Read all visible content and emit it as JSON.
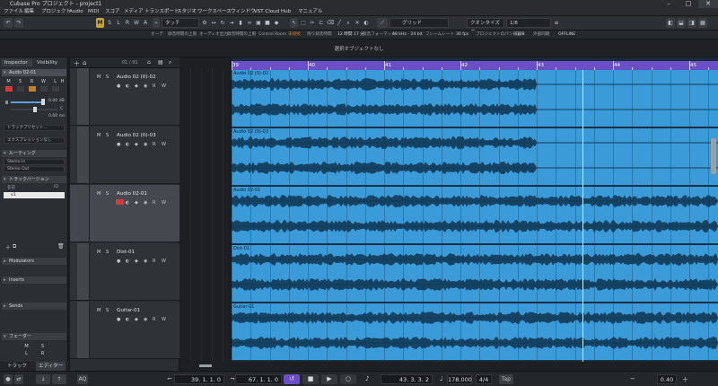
{
  "window": {
    "title": "Cubase Pro プロジェクト - project1"
  },
  "menu": [
    "ファイル",
    "編集",
    "プロジェクト",
    "Audio",
    "MIDI",
    "スコア",
    "メディア",
    "トランスポート",
    "スタジオ",
    "ワークスペース",
    "ウィンドウ",
    "VST Cloud",
    "Hub",
    "マニュアル"
  ],
  "toolbar": {
    "modes": [
      "M",
      "S",
      "L",
      "R",
      "W",
      "A"
    ],
    "touch_label": "タッチ",
    "grid_label": "グリッド",
    "quantize_label": "クオンタイズ値",
    "quantize_value": "1/8"
  },
  "status": [
    "オーデ",
    "録音時間の上限",
    "オーディオ出力",
    "録音時間の上限",
    "Control Room",
    "未接続",
    "残り録音時間",
    "12 時間 17 分",
    "録音フォーマット",
    "48 kHz - 24 bit",
    "フレームレート",
    "30 fps",
    "プロジェクトのパン補正",
    "-3dB",
    "外部同期",
    "OFFLINE"
  ],
  "info": "選択オブジェクトなし",
  "inspector": {
    "tab_inspector": "Inspector",
    "tab_visibility": "Visibility",
    "track_name": "Audio 02-01",
    "buttons": [
      "M",
      "S",
      "R",
      "W",
      "L",
      "H"
    ],
    "volume": "0.00 dB",
    "pan": "C",
    "delay": "0.00 ms",
    "input_dropdown": "トラックプリセット...",
    "routing_dropdown": "エクスプレッションなし",
    "routing_section": "ルーティング",
    "in_value": "Stereo In",
    "out_value": "Stereo Out",
    "versions_section": "トラックバージョン",
    "versions_cols": [
      "名前",
      "ID"
    ],
    "version_row": "v1",
    "modulators": "Modulators",
    "inserts": "Inserts",
    "sends": "Sends",
    "fader": "フェーダー",
    "fader_btns": [
      "M",
      "S",
      "L",
      "R"
    ],
    "bottom_tabs": [
      "トラック",
      "エディター"
    ]
  },
  "tracklist": {
    "counter": "01 / 01",
    "tracks": [
      {
        "name": "Audio 02 (0)-02",
        "selected": false,
        "rec": false
      },
      {
        "name": "Audio 02 (0)-03",
        "selected": false,
        "rec": false
      },
      {
        "name": "Audio 02-01",
        "selected": true,
        "rec": true
      },
      {
        "name": "Dist-01",
        "selected": false,
        "rec": false
      },
      {
        "name": "Guitar-01",
        "selected": false,
        "rec": false
      }
    ]
  },
  "ruler": {
    "bars": [
      "39",
      "40",
      "41",
      "42",
      "43",
      "44",
      "45"
    ]
  },
  "clips": [
    "Audio 02 (0)-02",
    "Audio 02 (0)-03",
    "Audio 02-01",
    "Dist-01",
    "Guitar-01"
  ],
  "transport": {
    "left_locator": "39. 1. 1. 0",
    "right_locator": "67. 1. 1. 0",
    "position": "43. 3. 3. 2",
    "tempo": "178.000",
    "signature": "4/4",
    "tap": "Tap",
    "zoom": "0.40"
  },
  "colors": {
    "accent": "#6a4fc6",
    "clip": "#3a9bd8",
    "record": "#d43a3a",
    "toggle": "#c9a23a"
  }
}
